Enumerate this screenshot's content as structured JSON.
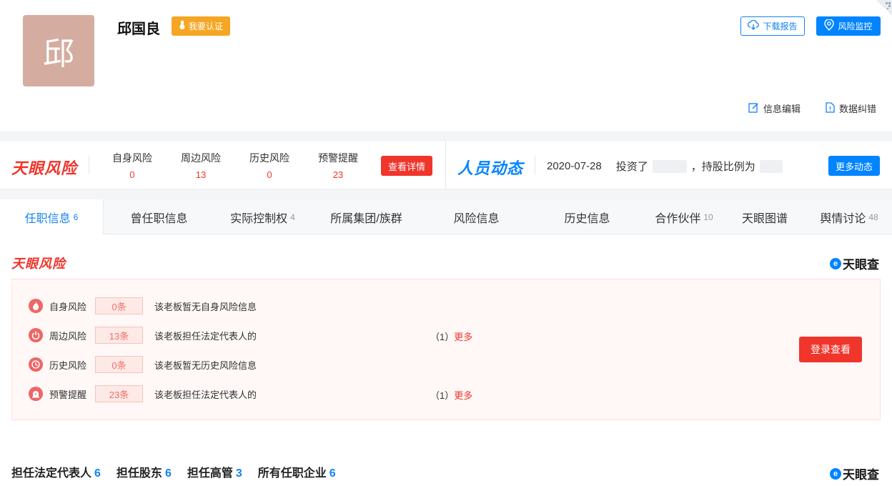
{
  "header": {
    "avatar_char": "邱",
    "person_name": "邱国良",
    "verify_label": "我要认证",
    "download_label": "下载报告",
    "monitor_label": "风险监控",
    "edit_label": "信息编辑",
    "correct_label": "数据纠错"
  },
  "riskbar": {
    "logo": "天眼风险",
    "stats": [
      {
        "label": "自身风险",
        "value": "0"
      },
      {
        "label": "周边风险",
        "value": "13"
      },
      {
        "label": "历史风险",
        "value": "0"
      },
      {
        "label": "预警提醒",
        "value": "23"
      }
    ],
    "detail_button": "查看详情"
  },
  "dynamics": {
    "logo": "人员动态",
    "date": "2020-07-28",
    "text_invest": "投资了",
    "text_ratio": "，持股比例为",
    "more_button": "更多动态"
  },
  "tabs": [
    {
      "label": "任职信息",
      "count": "6"
    },
    {
      "label": "曾任职信息",
      "count": ""
    },
    {
      "label": "实际控制权",
      "count": "4"
    },
    {
      "label": "所属集团/族群",
      "count": ""
    },
    {
      "label": "风险信息",
      "count": ""
    },
    {
      "label": "历史信息",
      "count": ""
    },
    {
      "label": "合作伙伴",
      "count": "10"
    },
    {
      "label": "天眼图谱",
      "count": ""
    },
    {
      "label": "舆情讨论",
      "count": "48"
    }
  ],
  "risk_section": {
    "title": "天眼风险",
    "brand": "天眼查",
    "rows": [
      {
        "label": "自身风险",
        "count": "0条",
        "desc": "该老板暂无自身风险信息",
        "more_num": "",
        "more": ""
      },
      {
        "label": "周边风险",
        "count": "13条",
        "desc": "该老板担任法定代表人的",
        "more_num": "（1）",
        "more": "更多"
      },
      {
        "label": "历史风险",
        "count": "0条",
        "desc": "该老板暂无历史风险信息",
        "more_num": "",
        "more": ""
      },
      {
        "label": "预警提醒",
        "count": "23条",
        "desc": "该老板担任法定代表人的",
        "more_num": "（1）",
        "more": "更多"
      }
    ],
    "login_button": "登录查看"
  },
  "subtabs": [
    {
      "label": "担任法定代表人",
      "count": "6"
    },
    {
      "label": "担任股东",
      "count": "6"
    },
    {
      "label": "担任高管",
      "count": "3"
    },
    {
      "label": "所有任职企业",
      "count": "6"
    }
  ],
  "bottom_brand": "天眼查"
}
